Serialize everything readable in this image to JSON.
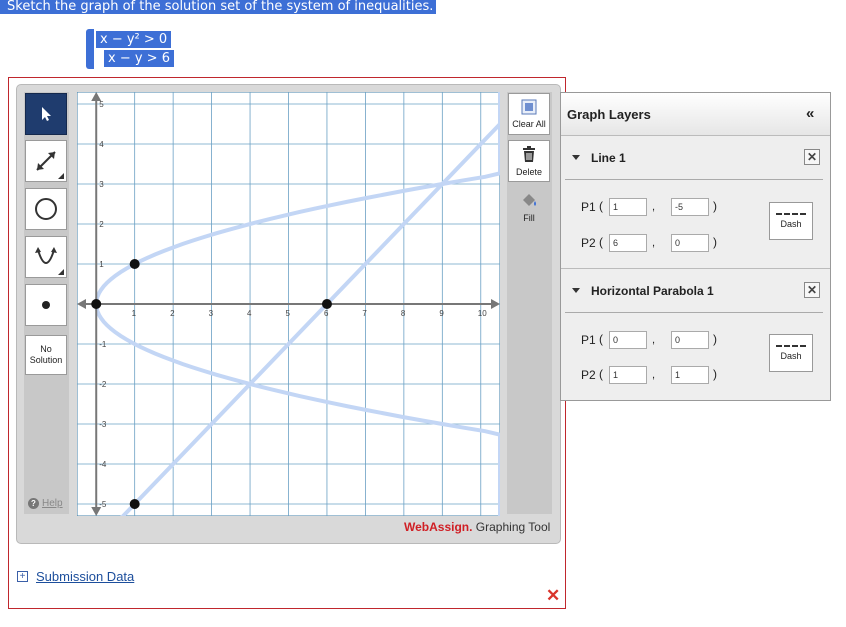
{
  "question": {
    "text": "Sketch the graph of the solution set of the system of inequalities.",
    "system": {
      "line1": "x − y² > 0",
      "line2": "x − y > 6"
    }
  },
  "toolbar_left": {
    "no_solution_line1": "No",
    "no_solution_line2": "Solution",
    "help": "Help",
    "tools": [
      "pointer-icon",
      "line-tool-icon",
      "circle-tool-icon",
      "parabola-tool-icon",
      "point-tool-icon"
    ]
  },
  "toolbar_right": {
    "clear_all": "Clear All",
    "delete": "Delete",
    "fill": "Fill"
  },
  "brand": {
    "part1": "WebAssign.",
    "part2": " Graphing Tool"
  },
  "submission": {
    "label": "Submission Data"
  },
  "layers": {
    "title": "Graph Layers",
    "collapse": "«",
    "items": [
      {
        "name": "Line 1",
        "p1_label": "P1",
        "p2_label": "P2",
        "p1": [
          "1",
          "-5"
        ],
        "p2": [
          "6",
          "0"
        ],
        "dash_label": "Dash"
      },
      {
        "name": "Horizontal Parabola 1",
        "p1_label": "P1",
        "p2_label": "P2",
        "p1": [
          "0",
          "0"
        ],
        "p2": [
          "1",
          "1"
        ],
        "dash_label": "Dash"
      }
    ]
  },
  "chart_data": {
    "type": "line",
    "x_ticks": [
      "1",
      "2",
      "3",
      "4",
      "5",
      "6",
      "7",
      "8",
      "9",
      "10"
    ],
    "y_ticks_pos": [
      "1",
      "2",
      "3",
      "4",
      "5"
    ],
    "y_ticks_neg": [
      "-1",
      "-2",
      "-3",
      "-4",
      "-5"
    ],
    "xlim": [
      -0.5,
      10.5
    ],
    "ylim": [
      -5.3,
      5.3
    ],
    "grid": true,
    "curves": [
      {
        "kind": "line",
        "through": [
          [
            1,
            -5
          ],
          [
            6,
            0
          ]
        ],
        "style": "dashed"
      },
      {
        "kind": "horizontal-parabola",
        "vertex": [
          0,
          0
        ],
        "point": [
          1,
          1
        ],
        "style": "dashed"
      }
    ],
    "points": [
      [
        1,
        1
      ],
      [
        1,
        -5
      ],
      [
        6,
        0
      ],
      [
        0,
        0
      ]
    ],
    "curve_color": "#c3d6f5"
  },
  "colors": {
    "accent": "#3d6fd6",
    "frame": "#c0272d",
    "brand_red": "#d01f25"
  }
}
